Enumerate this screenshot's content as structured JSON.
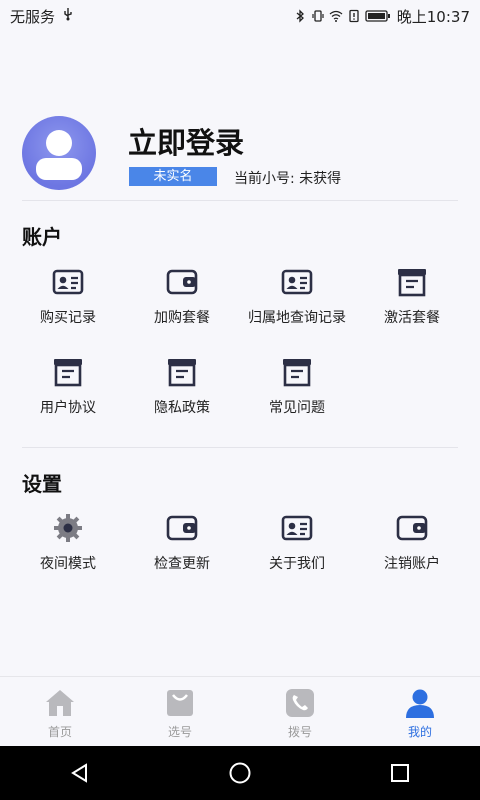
{
  "status_bar": {
    "carrier": "无服务",
    "time": "晚上10:37"
  },
  "profile": {
    "login_label": "立即登录",
    "realname_badge": "未实名",
    "current_number": "当前小号: 未获得"
  },
  "account": {
    "title": "账户",
    "items": [
      {
        "label": "购买记录",
        "icon": "id-card-icon"
      },
      {
        "label": "加购套餐",
        "icon": "wallet-icon"
      },
      {
        "label": "归属地查询记录",
        "icon": "id-card-icon"
      },
      {
        "label": "激活套餐",
        "icon": "archive-box-icon"
      },
      {
        "label": "用户协议",
        "icon": "archive-box-icon"
      },
      {
        "label": "隐私政策",
        "icon": "archive-box-icon"
      },
      {
        "label": "常见问题",
        "icon": "archive-box-icon"
      }
    ]
  },
  "settings": {
    "title": "设置",
    "items": [
      {
        "label": "夜间模式",
        "icon": "gear-icon"
      },
      {
        "label": "检查更新",
        "icon": "wallet-icon"
      },
      {
        "label": "关于我们",
        "icon": "id-card-icon"
      },
      {
        "label": "注销账户",
        "icon": "wallet-icon"
      }
    ]
  },
  "tabbar": {
    "tabs": [
      {
        "label": "首页",
        "icon": "home-icon",
        "active": false
      },
      {
        "label": "选号",
        "icon": "bag-icon",
        "active": false
      },
      {
        "label": "拨号",
        "icon": "phone-icon",
        "active": false
      },
      {
        "label": "我的",
        "icon": "user-icon",
        "active": true
      }
    ]
  },
  "colors": {
    "accent": "#2d6fe0",
    "badge": "#4a86e8",
    "icon_dark": "#2c2f45",
    "avatar": "#7b83e8"
  }
}
